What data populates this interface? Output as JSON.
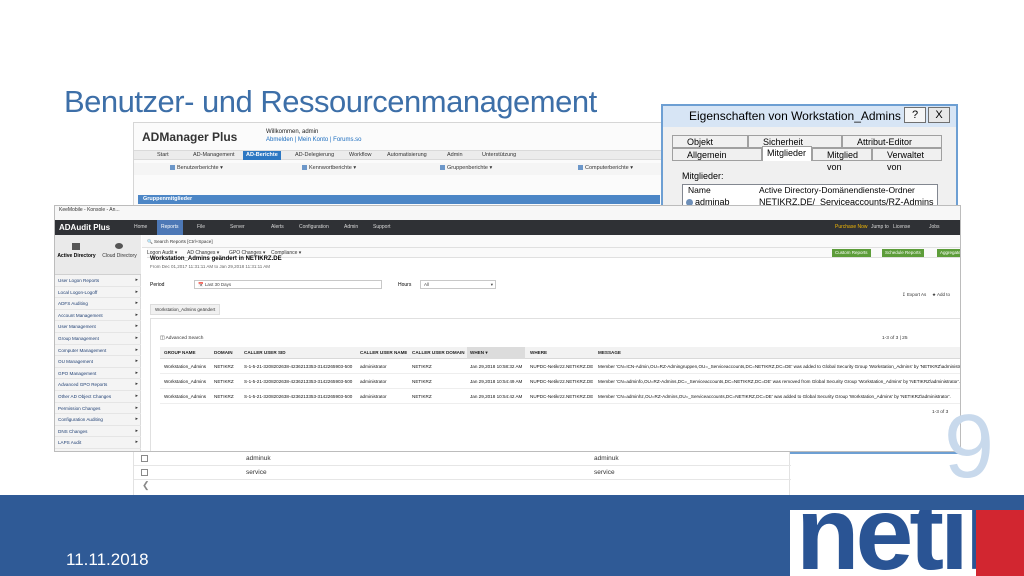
{
  "slide": {
    "title": "Benutzer- und Ressourcenmanagement",
    "date": "11.11.2018",
    "page_number": "9",
    "logo_text": "netik",
    "colors": {
      "title": "#3d6fa8",
      "band": "#2f5a96",
      "logo": "#2a5494",
      "accent": "#d22630"
    }
  },
  "admanager": {
    "logo": "ADManager Plus",
    "welcome": "Willkommen, admin",
    "links": "Abmelden | Mein Konto | Forums.so",
    "nav": [
      "Start",
      "AD-Management",
      "AD-Berichte",
      "AD-Delegierung",
      "Workflow",
      "Automatisierung",
      "Admin",
      "Unterstützung"
    ],
    "active_nav": "AD-Berichte",
    "subnav": [
      "Benutzerberichte",
      "Kennwortberichte",
      "Gruppenberichte",
      "Computerberichte"
    ],
    "section_bar": "Gruppenmitglieder"
  },
  "dialog": {
    "title": "Eigenschaften von Workstation_Admins",
    "help": "?",
    "close": "X",
    "tabs_row1": [
      "Objekt",
      "Sicherheit",
      "Attribut-Editor"
    ],
    "tabs_row2": [
      "Allgemein",
      "Mitglieder",
      "Mitglied von",
      "Verwaltet von"
    ],
    "selected_tab": "Mitglieder",
    "members_label": "Mitglieder:",
    "col_name": "Name",
    "col_folder": "Active Directory-Domänendienste-Ordner",
    "member_name": "adminab",
    "member_folder": "NETIKRZ.DE/_Serviceaccounts/RZ-Admins"
  },
  "adaudit": {
    "bookmarks": "KeeMobile - Konsole - An...",
    "brand": "ADAudit Plus",
    "top_nav": [
      "Home",
      "Reports",
      "File Audit",
      "Server Audit",
      "Alerts",
      "Configuration",
      "Admin",
      "Support"
    ],
    "active_top": "Reports",
    "top_right": [
      "Purchase Now",
      "Jump to",
      "License",
      "Jobs"
    ],
    "side_tabs": [
      "Active Directory",
      "Cloud Directory"
    ],
    "search_placeholder": "Search Reports [Ctrl+Space]",
    "sub_nav": [
      "Logon Audit",
      "AD Changes",
      "GPO Changes",
      "Compliance"
    ],
    "sub_buttons": [
      "Custom Reports",
      "Schedule Reports",
      "Aggregate"
    ],
    "side_menu": [
      "User Logon Reports",
      "Local Logon-Logoff",
      "ADFS Auditing",
      "Account Management",
      "User Management",
      "Group Management",
      "Computer Management",
      "OU Management",
      "GPO Management",
      "Advanced GPO Reports",
      "Other AD Object Changes",
      "Permission Changes",
      "Configuration Auditing",
      "DNS Changes",
      "LAPS Audit"
    ],
    "report_title": "Workstation_Admins geändert in NETIKRZ.DE",
    "report_sub": "From Dec 01,2017 11:31:11 AM to Jan 29,2018 11:31:11 AM",
    "period_label": "Period",
    "period_value": "Last 30 Days",
    "hours_label": "Hours",
    "hours_value": "All",
    "tools": [
      "Export As",
      "Add to"
    ],
    "pill": "Workstation_Admins geändert",
    "advanced_search": "Advanced Search",
    "paging_top": "1-3 of 3  |  25",
    "paging_bottom": "1-3 of 3",
    "columns": [
      "GROUP NAME",
      "DOMAIN",
      "CALLER USER SID",
      "CALLER USER NAME",
      "CALLER USER DOMAIN",
      "WHEN",
      "WHERE",
      "MESSAGE"
    ],
    "rows": [
      [
        "Workstation_Admins",
        "NETIKRZ",
        "S-1-5-21-3208202638-4236213353-3142265903-500",
        "administrator",
        "NETIKRZ",
        "Jan 29,2018 10:58:32 AM",
        "NUPDC-Netikrz2.NETIKRZ.DE",
        "Member 'CN=ICN-Admin,OU=RZ-Admingruppen,OU=_Serviceaccounts,DC=NETIKRZ,DC=DE' was added to Global Security Group 'Workstation_Admins' by 'NETIKRZ\\administrator'."
      ],
      [
        "Workstation_Admins",
        "NETIKRZ",
        "S-1-5-21-3208202638-4236213353-3142265903-500",
        "administrator",
        "NETIKRZ",
        "Jan 29,2018 10:54:49 AM",
        "NUPDC-Netikrz2.NETIKRZ.DE",
        "Member 'CN=adminfo,OU=RZ-Admins,DC=_Serviceaccounts,DC=NETIKRZ,DC=DE' was removed from Global Security Group 'Workstation_Admins' by 'NETIKRZ\\administrator'."
      ],
      [
        "Workstation_Admins",
        "NETIKRZ",
        "S-1-5-21-3208202638-4236213353-3142265903-500",
        "administrator",
        "NETIKRZ",
        "Jan 29,2018 10:54:42 AM",
        "NUPDC-Netikrz2.NETIKRZ.DE",
        "Member 'CN=adminhz,OU=RZ-Admins,OU=_Serviceaccounts,DC=NETIKRZ,DC=DE' was added to Global Security Group 'Workstation_Admins' by 'NETIKRZ\\administrator'."
      ]
    ]
  },
  "lower_list": {
    "rows": [
      [
        "adminuk",
        "adminuk"
      ],
      [
        "service",
        "service"
      ]
    ]
  }
}
